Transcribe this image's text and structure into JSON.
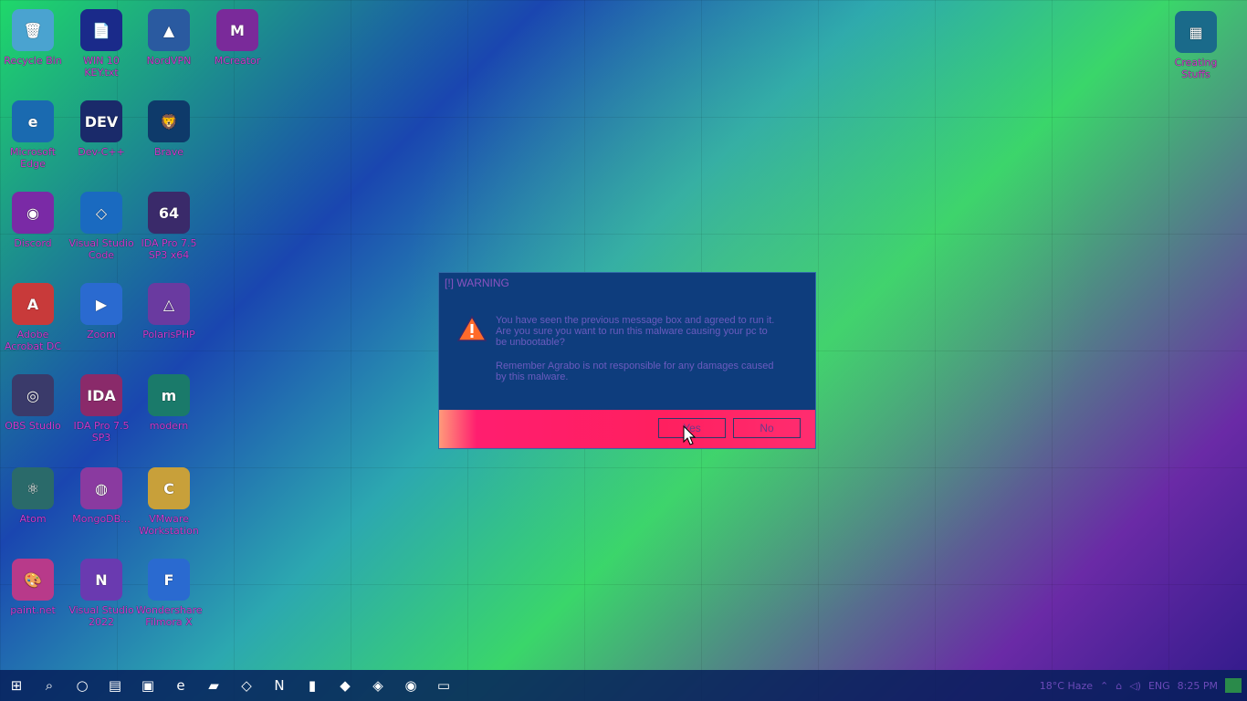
{
  "desktop": {
    "icons": [
      {
        "label": "Recycle Bin",
        "icon": "recycle-bin-icon",
        "glyph": "🗑",
        "bg": "#4aa3d0"
      },
      {
        "label": "WIN 10 KEY.txt",
        "icon": "text-file-icon",
        "glyph": "📄",
        "bg": "#1a2a8a"
      },
      {
        "label": "NordVPN",
        "icon": "nordvpn-icon",
        "glyph": "▲",
        "bg": "#2a5aa0"
      },
      {
        "label": "MCreator",
        "icon": "mcreator-icon",
        "glyph": "M",
        "bg": "#7a2a9a"
      },
      {
        "label": "Microsoft Edge",
        "icon": "edge-icon",
        "glyph": "e",
        "bg": "#1a6ab0"
      },
      {
        "label": "Dev-C++",
        "icon": "devcpp-icon",
        "glyph": "DEV",
        "bg": "#1a2a6a"
      },
      {
        "label": "Brave",
        "icon": "brave-icon",
        "glyph": "🦁",
        "bg": "#0e3a6a"
      },
      {
        "label": "Discord",
        "icon": "discord-icon",
        "glyph": "◉",
        "bg": "#7a2aa6"
      },
      {
        "label": "Visual Studio Code",
        "icon": "vscode-icon",
        "glyph": "◇",
        "bg": "#1a6ac0"
      },
      {
        "label": "IDA Pro 7.5 SP3 x64",
        "icon": "ida-icon",
        "glyph": "64",
        "bg": "#3a2a6a"
      },
      {
        "label": "Adobe Acrobat DC",
        "icon": "acrobat-icon",
        "glyph": "A",
        "bg": "#c83a3a"
      },
      {
        "label": "Zoom",
        "icon": "zoom-icon",
        "glyph": "▶",
        "bg": "#2a6ad0"
      },
      {
        "label": "PolarisPHP",
        "icon": "polaris-icon",
        "glyph": "△",
        "bg": "#6a3aa0"
      },
      {
        "label": "OBS Studio",
        "icon": "obs-icon",
        "glyph": "◎",
        "bg": "#3a3a6a"
      },
      {
        "label": "IDA Pro 7.5 SP3",
        "icon": "ida-icon",
        "glyph": "IDA",
        "bg": "#8a2a6a"
      },
      {
        "label": "modern",
        "icon": "modern-icon",
        "glyph": "m",
        "bg": "#1a7a6a"
      },
      {
        "label": "Atom",
        "icon": "atom-icon",
        "glyph": "⚛",
        "bg": "#2a6a6a"
      },
      {
        "label": "MongoDB...",
        "icon": "mongodb-icon",
        "glyph": "◍",
        "bg": "#8a3aa0"
      },
      {
        "label": "VMware Workstation",
        "icon": "vmware-icon",
        "glyph": "C",
        "bg": "#c8a03a"
      },
      {
        "label": "paint.net",
        "icon": "paintnet-icon",
        "glyph": "🎨",
        "bg": "#b83a8a"
      },
      {
        "label": "Visual Studio 2022",
        "icon": "visualstudio-icon",
        "glyph": "N",
        "bg": "#6a3ab0"
      },
      {
        "label": "Wondershare Filmora X",
        "icon": "filmora-icon",
        "glyph": "F",
        "bg": "#2a6ad0"
      }
    ],
    "right_icon": {
      "label": "Creating Stuffs",
      "icon": "folder-icon",
      "glyph": "▦"
    }
  },
  "dialog": {
    "title": "[!] WARNING",
    "line1": "You have seen the previous message box and agreed to run it.",
    "line2": "Are you sure you want to run this malware causing your pc to",
    "line3": "be unbootable?",
    "line4": "Remember Agrabo is not responsible for any damages caused",
    "line5": "by this malware.",
    "yes_label": "Yes",
    "no_label": "No"
  },
  "taskbar": {
    "items": [
      {
        "name": "start-button",
        "glyph": "⊞"
      },
      {
        "name": "search-button",
        "glyph": "⌕"
      },
      {
        "name": "cortana-button",
        "glyph": "○"
      },
      {
        "name": "task-view-button",
        "glyph": "▤"
      },
      {
        "name": "store-button",
        "glyph": "▣"
      },
      {
        "name": "edge-taskbar",
        "glyph": "e"
      },
      {
        "name": "explorer-taskbar",
        "glyph": "▰"
      },
      {
        "name": "vscode-taskbar",
        "glyph": "◇"
      },
      {
        "name": "visualstudio-taskbar",
        "glyph": "N"
      },
      {
        "name": "notes-taskbar",
        "glyph": "▮"
      },
      {
        "name": "brave-taskbar",
        "glyph": "◆"
      },
      {
        "name": "app-taskbar",
        "glyph": "◈"
      },
      {
        "name": "discord-taskbar",
        "glyph": "◉"
      },
      {
        "name": "active-app-taskbar",
        "glyph": "▭"
      }
    ],
    "weather": "18°C  Haze",
    "lang": "ENG",
    "time": "8:25 PM"
  }
}
